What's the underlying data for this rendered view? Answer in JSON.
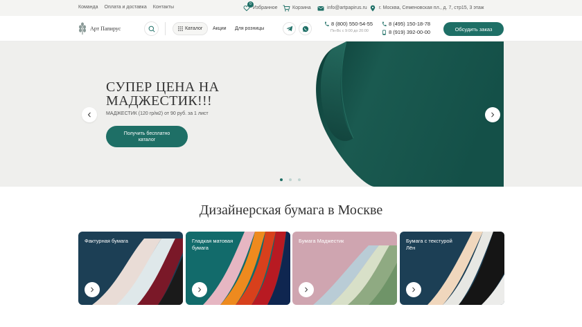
{
  "topbar": {
    "links": [
      "Команда",
      "Оплата и доставка",
      "Контакты"
    ],
    "favorites_label": "Избранное",
    "favorites_count": "0",
    "cart_label": "Корзина",
    "email": "info@artpapirus.ru",
    "address": "г. Москва, Семеновская пл., д. 7, стр15, 3 этаж"
  },
  "header": {
    "logo_text": "Арт Папирус",
    "catalog_label": "Каталог",
    "nav": [
      "Акции",
      "Для розницы"
    ],
    "phone_main": "8 (800) 550-54-55",
    "phone_hours": "Пн-Вс с 9:00 до 20:00",
    "phone_2": "8 (495) 150-18-78",
    "phone_3": "8 (919) 392-00-00",
    "order_button": "Обсудить заказ"
  },
  "hero": {
    "title": "СУПЕР ЦЕНА НА МАДЖЕСТИК!!!",
    "subtitle": "МАДЖЕСТИК (120 гр/м2)  от 90 руб. за 1 лист",
    "cta": "Получить бесплатно каталог",
    "slides_total": 3,
    "active_slide": 1
  },
  "section": {
    "title": "Дизайнерская бумага в Москве",
    "cards": [
      {
        "label": "Фактурная бумага"
      },
      {
        "label": "Гладкая матовая бумага"
      },
      {
        "label": "Бумага Маджестик"
      },
      {
        "label": "Бумага с текстурой Лён"
      }
    ]
  },
  "colors": {
    "accent": "#1e6f66",
    "hero_bg": "#efefed",
    "topbar_bg": "#f4f4f2"
  }
}
